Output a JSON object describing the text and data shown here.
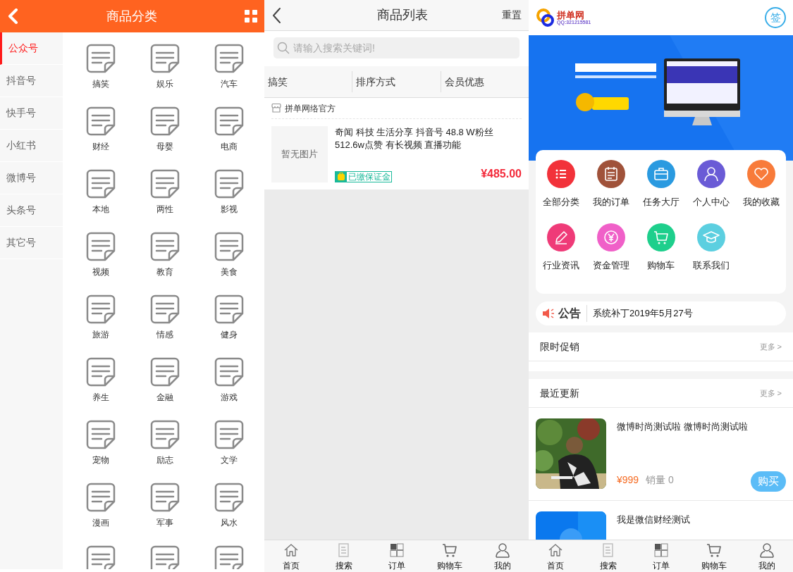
{
  "category_screen": {
    "title": "商品分类",
    "sidebar": [
      {
        "label": "公众号",
        "selected": true
      },
      {
        "label": "抖音号",
        "selected": false
      },
      {
        "label": "快手号",
        "selected": false
      },
      {
        "label": "小红书",
        "selected": false
      },
      {
        "label": "微博号",
        "selected": false
      },
      {
        "label": "头条号",
        "selected": false
      },
      {
        "label": "其它号",
        "selected": false
      }
    ],
    "categories": [
      {
        "kind": "full",
        "label": "搞笑"
      },
      {
        "kind": "full",
        "label": "娱乐"
      },
      {
        "kind": "full",
        "label": "汽车"
      },
      {
        "kind": "full",
        "label": "财经"
      },
      {
        "kind": "full",
        "label": "母婴"
      },
      {
        "kind": "full",
        "label": "电商"
      },
      {
        "kind": "full",
        "label": "本地"
      },
      {
        "kind": "full",
        "label": "两性"
      },
      {
        "kind": "full",
        "label": "影视"
      },
      {
        "kind": "full",
        "label": "视频"
      },
      {
        "kind": "full",
        "label": "教育"
      },
      {
        "kind": "full",
        "label": "美食"
      },
      {
        "kind": "full",
        "label": "旅游"
      },
      {
        "kind": "full",
        "label": "情感"
      },
      {
        "kind": "full",
        "label": "健身"
      },
      {
        "kind": "full",
        "label": "养生"
      },
      {
        "kind": "full",
        "label": "金融"
      },
      {
        "kind": "full",
        "label": "游戏"
      },
      {
        "kind": "full",
        "label": "宠物"
      },
      {
        "kind": "full",
        "label": "励志"
      },
      {
        "kind": "full",
        "label": "文学"
      },
      {
        "kind": "full",
        "label": "漫画"
      },
      {
        "kind": "full",
        "label": "军事"
      },
      {
        "kind": "full",
        "label": "风水"
      },
      {
        "kind": "icon_only"
      },
      {
        "kind": "icon_only"
      },
      {
        "kind": "icon_only"
      }
    ]
  },
  "list_screen": {
    "title": "商品列表",
    "reset": "重置",
    "search": {
      "placeholder": "请输入搜索关键词!"
    },
    "filters": [
      "搞笑",
      "排序方式",
      "会员优惠"
    ],
    "shop": "拼单网络官方",
    "product": {
      "image_text": "暂无图片",
      "title": "奇闻 科技 生活分享 抖音号 48.8 W粉丝 512.6w点赞 有长视频 直播功能",
      "badge": "已缴保证金",
      "price": "¥485.00"
    },
    "tabbar": [
      "首页",
      "搜索",
      "订单",
      "购物车",
      "我的"
    ]
  },
  "home_screen": {
    "logo": {
      "name": "拼单网",
      "qq": "QQ:321215581"
    },
    "sign": "签",
    "menu": [
      {
        "label": "全部分类",
        "color": "#f2323a"
      },
      {
        "label": "我的订单",
        "color": "#a0523a"
      },
      {
        "label": "任务大厅",
        "color": "#2a9ae0"
      },
      {
        "label": "个人中心",
        "color": "#6a5bd6"
      },
      {
        "label": "我的收藏",
        "color": "#f87b3a"
      },
      {
        "label": "行业资讯",
        "color": "#ef3b78"
      },
      {
        "label": "资金管理",
        "color": "#f060c8"
      },
      {
        "label": "购物车",
        "color": "#1ecf8c"
      },
      {
        "label": "联系我们",
        "color": "#5ccfe0"
      }
    ],
    "notice": {
      "label": "公告",
      "text": "系统补丁2019年5月27号"
    },
    "promo": {
      "title": "限时促销",
      "more": "更多 >"
    },
    "recent": {
      "title": "最近更新",
      "more": "更多 >",
      "items": [
        {
          "kind": "full",
          "title": "微博时尚测试啦 微博时尚测试啦",
          "price": "¥999",
          "sales": "销量 0",
          "button": "购买"
        },
        {
          "kind": "partial",
          "title": "我是微信财经测试"
        }
      ]
    },
    "tabbar": [
      "首页",
      "搜索",
      "订单",
      "购物车",
      "我的"
    ]
  }
}
